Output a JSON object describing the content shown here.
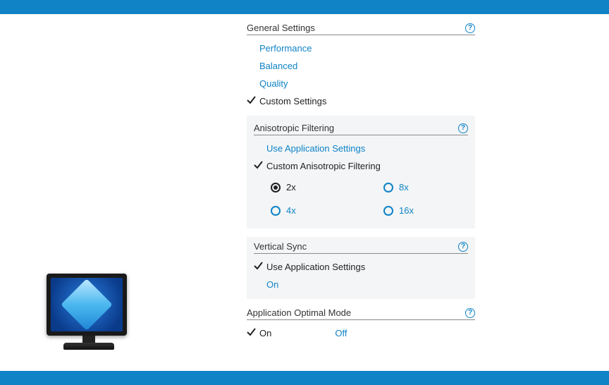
{
  "general": {
    "header": "General Settings",
    "options": {
      "performance": "Performance",
      "balanced": "Balanced",
      "quality": "Quality",
      "custom": "Custom Settings"
    }
  },
  "anisotropic": {
    "header": "Anisotropic Filtering",
    "useApp": "Use Application Settings",
    "custom": "Custom Anisotropic Filtering",
    "levels": {
      "x2": "2x",
      "x4": "4x",
      "x8": "8x",
      "x16": "16x"
    }
  },
  "vsync": {
    "header": "Vertical Sync",
    "useApp": "Use Application Settings",
    "on": "On"
  },
  "appOptimal": {
    "header": "Application Optimal Mode",
    "on": "On",
    "off": "Off"
  }
}
